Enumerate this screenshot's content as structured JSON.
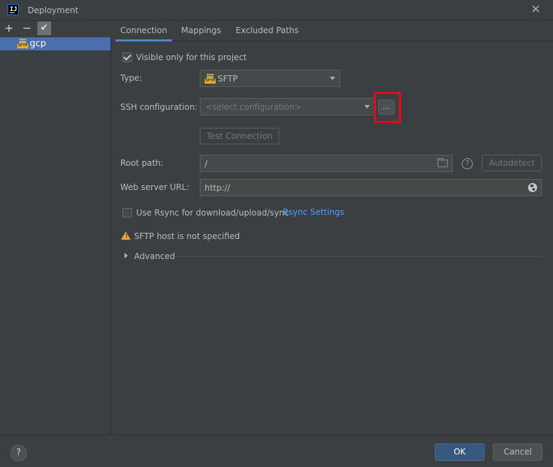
{
  "window": {
    "title": "Deployment",
    "app_icon_text": "IJ"
  },
  "left_toolbar": {
    "add_icon": "+",
    "remove_icon": "−",
    "check_icon": "✔"
  },
  "servers": [
    {
      "name": "gcp",
      "type_icon_text": "SFTP"
    }
  ],
  "tabs": [
    {
      "label": "Connection",
      "active": true
    },
    {
      "label": "Mappings",
      "active": false
    },
    {
      "label": "Excluded Paths",
      "active": false
    }
  ],
  "connection": {
    "visible_only_label": "Visible only for this project",
    "visible_only_checked": true,
    "type_label": "Type:",
    "type_value": "SFTP",
    "ssh_label": "SSH configuration:",
    "ssh_placeholder": "<select configuration>",
    "dots_label": "...",
    "test_connection_label": "Test Connection",
    "root_path_label": "Root path:",
    "root_path_value": "/",
    "help_icon_text": "?",
    "autodetect_label": "Autodetect",
    "web_url_label": "Web server URL:",
    "web_url_value": "http://",
    "rsync_label": "Use Rsync for download/upload/sync",
    "rsync_checked": false,
    "rsync_settings_link": "Rsync Settings",
    "warning_text": "SFTP host is not specified",
    "warning_icon_text": "!",
    "advanced_label": "Advanced"
  },
  "footer": {
    "help_text": "?",
    "ok_label": "OK",
    "cancel_label": "Cancel"
  },
  "colors": {
    "background": "#3c3f41",
    "selection": "#4b6eaf",
    "accent": "#4a88c7",
    "link": "#589df6",
    "highlight": "#e30d18",
    "warning": "#e8a33d"
  }
}
